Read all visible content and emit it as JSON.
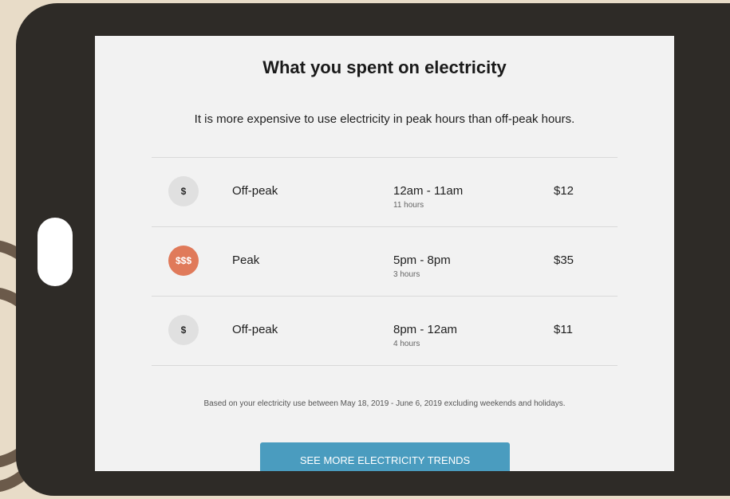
{
  "screen": {
    "title": "What you spent on electricity",
    "subtitle": "It is more expensive to use electricity in peak hours than off-peak hours.",
    "rates": [
      {
        "badge": "$",
        "label": "Off-peak",
        "time": "12am - 11am",
        "duration": "11 hours",
        "cost": "$12",
        "tier": "off-peak"
      },
      {
        "badge": "$$$",
        "label": "Peak",
        "time": "5pm - 8pm",
        "duration": "3 hours",
        "cost": "$35",
        "tier": "peak"
      },
      {
        "badge": "$",
        "label": "Off-peak",
        "time": "8pm - 12am",
        "duration": "4 hours",
        "cost": "$11",
        "tier": "off-peak"
      }
    ],
    "footnote": "Based on your electricity use between May 18, 2019 - June 6, 2019 excluding weekends and holidays.",
    "button_label": "SEE MORE ELECTRICITY TRENDS"
  },
  "colors": {
    "peak_badge": "#e07a5a",
    "offpeak_badge": "#e0e0e0",
    "button": "#4a9cbf",
    "tablet_frame": "#2e2b27"
  }
}
